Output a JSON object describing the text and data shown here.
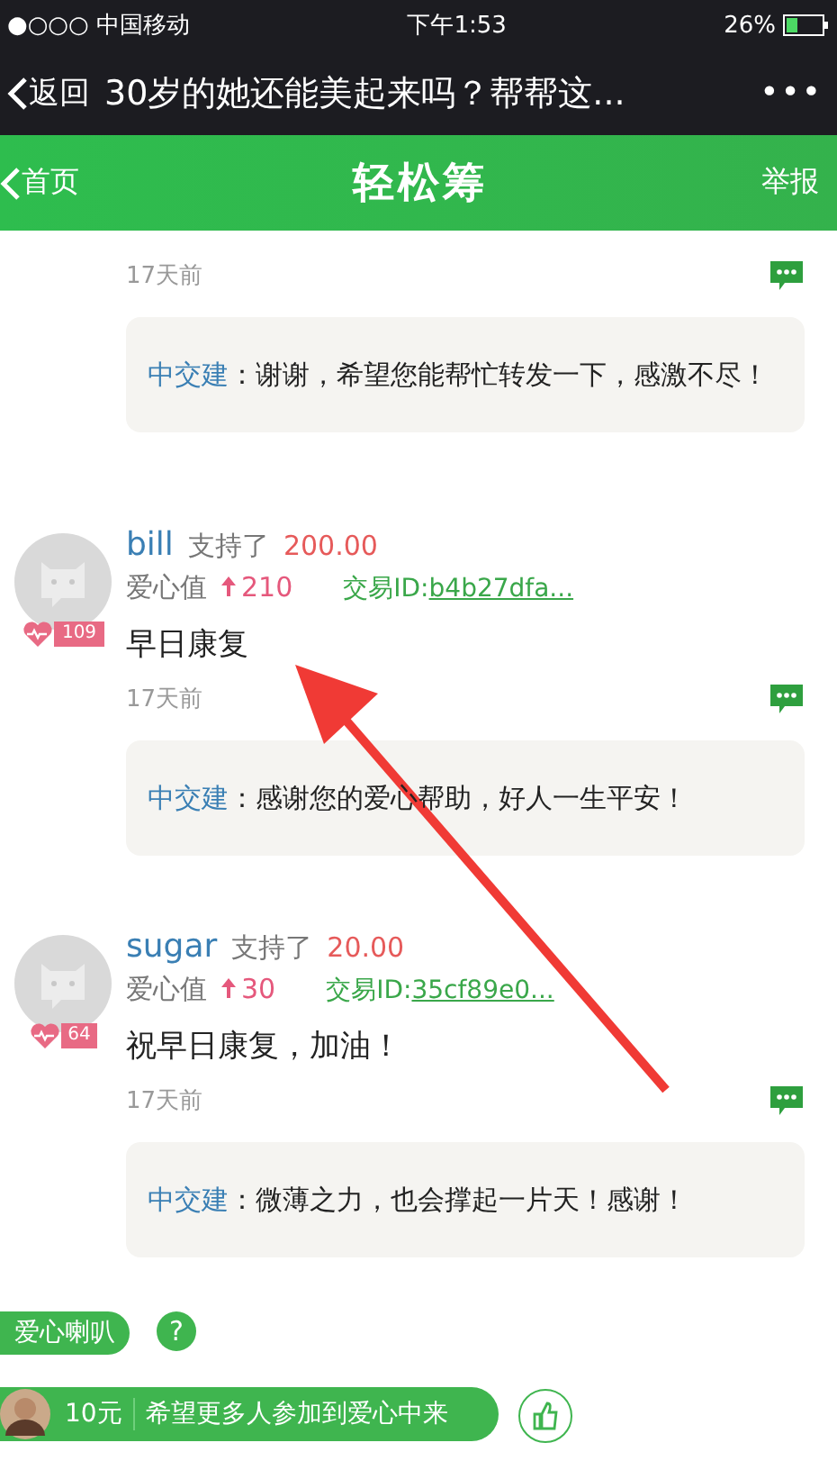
{
  "status_bar": {
    "carrier": "●○○○ 中国移动",
    "time": "下午1:53",
    "battery": "26%"
  },
  "nav_bar": {
    "back": "返回",
    "title": "30岁的她还能美起来吗？帮帮这...",
    "more": "•••"
  },
  "header": {
    "back": "首页",
    "title": "轻松筹",
    "report": "举报"
  },
  "previous": {
    "time": "17天前",
    "reply": {
      "author": "中交建",
      "text": "：谢谢，希望您能帮忙转发一下，感激不尽！"
    }
  },
  "comments": [
    {
      "name": "bill",
      "action": "支持了",
      "amount": "200.00",
      "love_label": "爱心值",
      "love_value": "210",
      "tx_label": "交易ID:",
      "tx_id": "b4b27dfa...",
      "badge": "109",
      "text": "早日康复",
      "time": "17天前",
      "reply": {
        "author": "中交建",
        "text": "：感谢您的爱心帮助，好人一生平安！"
      }
    },
    {
      "name": "sugar",
      "action": "支持了",
      "amount": "20.00",
      "love_label": "爱心值",
      "love_value": "30",
      "tx_label": "交易ID:",
      "tx_id": "35cf89e0...",
      "badge": "64",
      "text": "祝早日康复，加油！",
      "time": "17天前",
      "reply": {
        "author": "中交建",
        "text": "：微薄之力，也会撑起一片天！感谢！"
      }
    }
  ],
  "overlay": {
    "speaker_label": "爱心喇叭",
    "help": "?",
    "ticker_amount": "10元",
    "ticker_text": "希望更多人参加到爱心中来"
  }
}
